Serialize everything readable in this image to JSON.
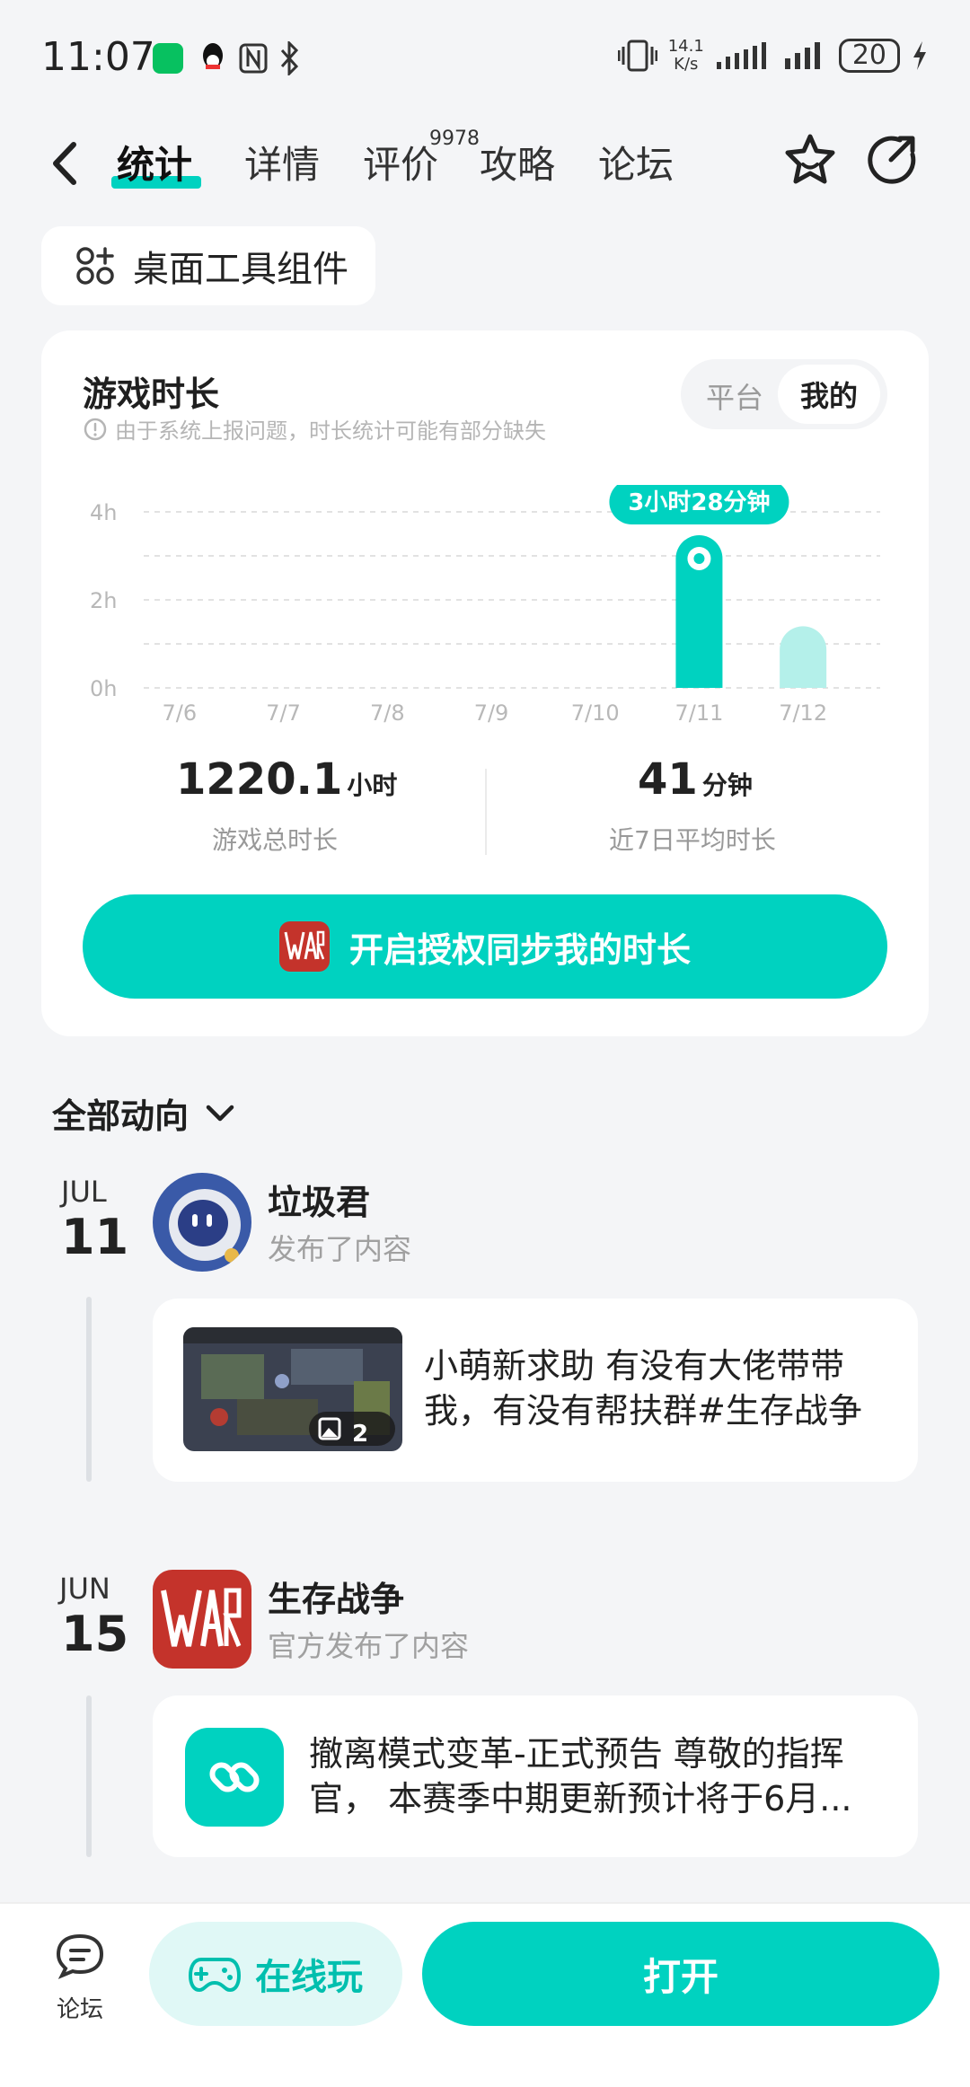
{
  "status_bar": {
    "time": "11:07",
    "net_speed_value": "14.1",
    "net_speed_unit": "K/s",
    "battery": "20",
    "app_icons": [
      "wechat-icon",
      "qq-icon",
      "nfc-icon",
      "bluetooth-icon"
    ],
    "right_icons": [
      "vibrate-icon",
      "signal-icon",
      "signal-icon",
      "charging-icon"
    ]
  },
  "nav": {
    "tabs": [
      {
        "label": "统计",
        "active": true
      },
      {
        "label": "详情",
        "active": false
      },
      {
        "label": "评价",
        "active": false,
        "badge": "9978"
      },
      {
        "label": "攻略",
        "active": false
      },
      {
        "label": "论坛",
        "active": false
      }
    ],
    "icons": [
      "back-icon",
      "star-icon",
      "share-icon"
    ]
  },
  "widget_chip": {
    "label": "桌面工具组件",
    "icon": "widgets-icon"
  },
  "playtime_card": {
    "title": "游戏时长",
    "note": "由于系统上报问题，时长统计可能有部分缺失",
    "segment": {
      "options": [
        "平台",
        "我的"
      ],
      "selected": "我的"
    },
    "tooltip": "3小时28分钟",
    "total": {
      "value": "1220.1",
      "unit": "小时",
      "label": "游戏总时长"
    },
    "average": {
      "value": "41",
      "unit": "分钟",
      "label": "近7日平均时长"
    },
    "sync_button": "开启授权同步我的时长",
    "colors": {
      "accent": "#00d2c0",
      "accent_light": "#b4f0ea"
    }
  },
  "chart_data": {
    "type": "bar",
    "categories": [
      "7/6",
      "7/7",
      "7/8",
      "7/9",
      "7/10",
      "7/11",
      "7/12"
    ],
    "values": [
      0,
      0,
      0,
      0,
      0,
      3.47,
      1.4
    ],
    "unit": "h",
    "yticks": [
      "0h",
      "2h",
      "4h"
    ],
    "ylim": [
      0,
      4
    ],
    "grid": true,
    "highlight_index": 5
  },
  "feed": {
    "header": "全部动向",
    "items": [
      {
        "month": "JUL",
        "day": "11",
        "user": "垃圾君",
        "action": "发布了内容",
        "text": "小萌新求助 有没有大佬带带我，有没有帮扶群#生存战争",
        "image_count": "2"
      },
      {
        "month": "JUN",
        "day": "15",
        "user": "生存战争",
        "action": "官方发布了内容",
        "text": "撤离模式变革-正式预告 尊敬的指挥官， 本赛季中期更新预计将于6月..."
      }
    ]
  },
  "bottom_bar": {
    "forum_label": "论坛",
    "online_label": "在线玩",
    "open_label": "打开"
  }
}
